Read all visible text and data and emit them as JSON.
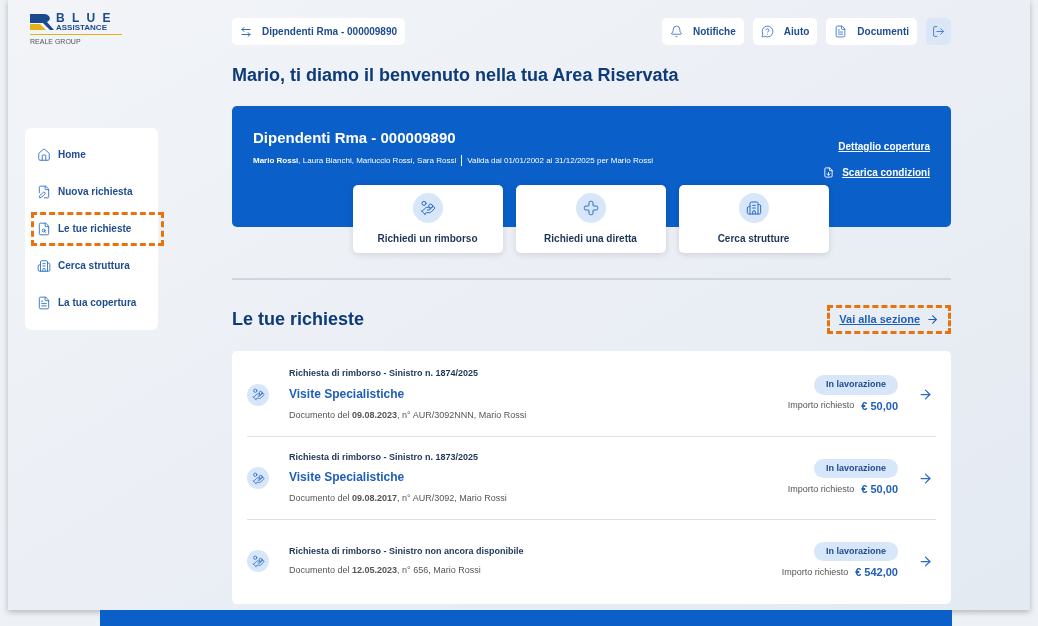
{
  "logo": {
    "word": "B L U E",
    "sub": "ASSISTANCE",
    "group": "REALE GROUP"
  },
  "policy_switch": {
    "label": "Dipendenti Rma - 000009890"
  },
  "top_actions": [
    {
      "kind": "bell",
      "label": "Notifiche"
    },
    {
      "kind": "help",
      "label": "Aiuto"
    },
    {
      "kind": "doc",
      "label": "Documenti"
    },
    {
      "kind": "logout"
    }
  ],
  "sidebar": {
    "items": [
      {
        "kind": "home",
        "label": "Home",
        "highlighted": false
      },
      {
        "kind": "new",
        "label": "Nuova richiesta",
        "highlighted": false
      },
      {
        "kind": "requests",
        "label": "Le tue richieste",
        "highlighted": true
      },
      {
        "kind": "building",
        "label": "Cerca struttura",
        "highlighted": false
      },
      {
        "kind": "coverage",
        "label": "La tua copertura",
        "highlighted": false
      }
    ]
  },
  "welcome_title": "Mario, ti diamo il benvenuto nella tua Area Riservata",
  "policy_card": {
    "title": "Dipendenti Rma - 000009890",
    "members": "**Mario Rossi**, Laura Bianchi, Mariuccio Rossi, Sara Rossi",
    "validity": "Valida dal 01/01/2002 al 31/12/2025 per Mario Rossi",
    "links": [
      {
        "kind": "plain",
        "label": "Dettaglio copertura"
      },
      {
        "kind": "pdf",
        "label": "Scarica condizioni"
      }
    ]
  },
  "quick_actions": [
    {
      "kind": "refund",
      "label": "Richiedi un rimborso"
    },
    {
      "kind": "direct",
      "label": "Richiedi una diretta"
    },
    {
      "kind": "building",
      "label": "Cerca strutture"
    }
  ],
  "requests_section": {
    "title": "Le tue richieste",
    "link": {
      "label": "Vai alla sezione",
      "highlighted": true
    },
    "rows": [
      {
        "heading": "Richiesta di rimborso - Sinistro n. 1874/2025",
        "subtitle": "Visite Specialistiche",
        "document": "Documento del **09.08.2023**, n° AUR/3092NNN, Mario Rossi",
        "status": "In lavorazione",
        "amount_label": "Importo richiesto",
        "amount": "€ 50,00"
      },
      {
        "heading": "Richiesta di rimborso - Sinistro n. 1873/2025",
        "subtitle": "Visite Specialistiche",
        "document": "Documento del **09.08.2017**, n° AUR/3092, Mario Rossi",
        "status": "In lavorazione",
        "amount_label": "Importo richiesto",
        "amount": "€ 50,00"
      },
      {
        "heading": "Richiesta di rimborso - Sinistro non ancora disponibile",
        "document": "Documento del **12.05.2023**, n° 656, Mario Rossi",
        "status": "In lavorazione",
        "amount_label": "Importo richiesto",
        "amount": "€ 542,00"
      }
    ]
  }
}
